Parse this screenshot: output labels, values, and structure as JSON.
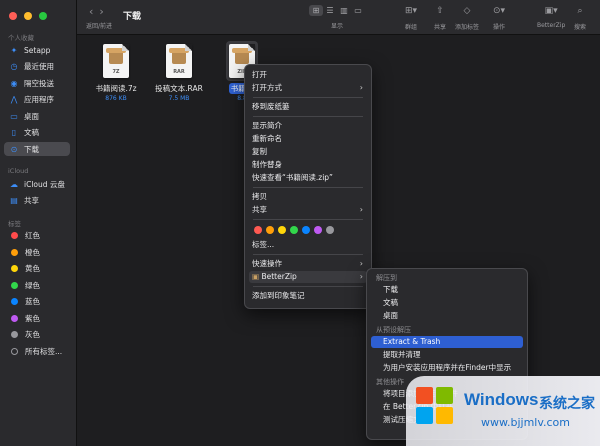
{
  "window": {
    "title": "下载",
    "nav_label": "返回/前进"
  },
  "toolbar": {
    "view_label": "显示",
    "group_label": "群组",
    "share_label": "共享",
    "tags_label": "添加标签",
    "action_label": "操作",
    "betterzip_label": "BetterZip",
    "search_label": "搜索"
  },
  "sidebar": {
    "favorites_header": "个人收藏",
    "favorites": [
      {
        "label": "Setapp",
        "icon": "setapp-icon"
      },
      {
        "label": "最近使用",
        "icon": "clock-icon"
      },
      {
        "label": "隔空投送",
        "icon": "airdrop-icon"
      },
      {
        "label": "应用程序",
        "icon": "applications-icon"
      },
      {
        "label": "桌面",
        "icon": "desktop-icon"
      },
      {
        "label": "文稿",
        "icon": "document-icon"
      },
      {
        "label": "下载",
        "icon": "download-icon"
      }
    ],
    "icloud_header": "iCloud",
    "icloud": [
      {
        "label": "iCloud 云盘",
        "icon": "cloud-icon"
      },
      {
        "label": "共享",
        "icon": "shared-folder-icon"
      }
    ],
    "tags_header": "标签",
    "tags": [
      {
        "label": "红色",
        "color": "#ff4b4b"
      },
      {
        "label": "橙色",
        "color": "#ff9f0a"
      },
      {
        "label": "黄色",
        "color": "#ffd60a"
      },
      {
        "label": "绿色",
        "color": "#32d74b"
      },
      {
        "label": "蓝色",
        "color": "#0a84ff"
      },
      {
        "label": "紫色",
        "color": "#bf5af2"
      },
      {
        "label": "灰色",
        "color": "#98989d"
      },
      {
        "label": "所有标签...",
        "color": ""
      }
    ]
  },
  "files": [
    {
      "name": "书籍阅读.7z",
      "ext": "7Z",
      "size": "876 KB"
    },
    {
      "name": "投稿文本.RAR",
      "ext": "RAR",
      "size": "7.5 MB"
    },
    {
      "name": "书籍阅",
      "ext": "ZIP",
      "size": "8.8"
    }
  ],
  "context_menu": {
    "items": [
      "打开",
      "打开方式",
      "移到废纸篓",
      "显示简介",
      "重新命名",
      "复制",
      "制作替身",
      "快速查看“书籍阅读.zip”",
      "拷贝",
      "共享",
      "标签...",
      "快速操作",
      "BetterZip",
      "添加到印象笔记"
    ],
    "tag_colors": [
      "#ff5a52",
      "#ff9f0a",
      "#ffd60a",
      "#32d74b",
      "#0a84ff",
      "#bf5af2",
      "#98989d"
    ]
  },
  "submenu": {
    "header_extract_to": "解压到",
    "extract_to": [
      "下载",
      "文稿",
      "桌面"
    ],
    "header_preset": "从预设解压",
    "preset": [
      "Extract & Trash",
      "提取并清理",
      "为用户安装应用程序并在Finder中显示"
    ],
    "header_other": "其他操作",
    "other": [
      "将项目添加到压缩文件",
      "在 BetterZip 中打开",
      "测试压缩文件"
    ]
  },
  "watermark": {
    "title": "Windows",
    "cn": "系统之家",
    "url": "www.bjjmlv.com"
  }
}
